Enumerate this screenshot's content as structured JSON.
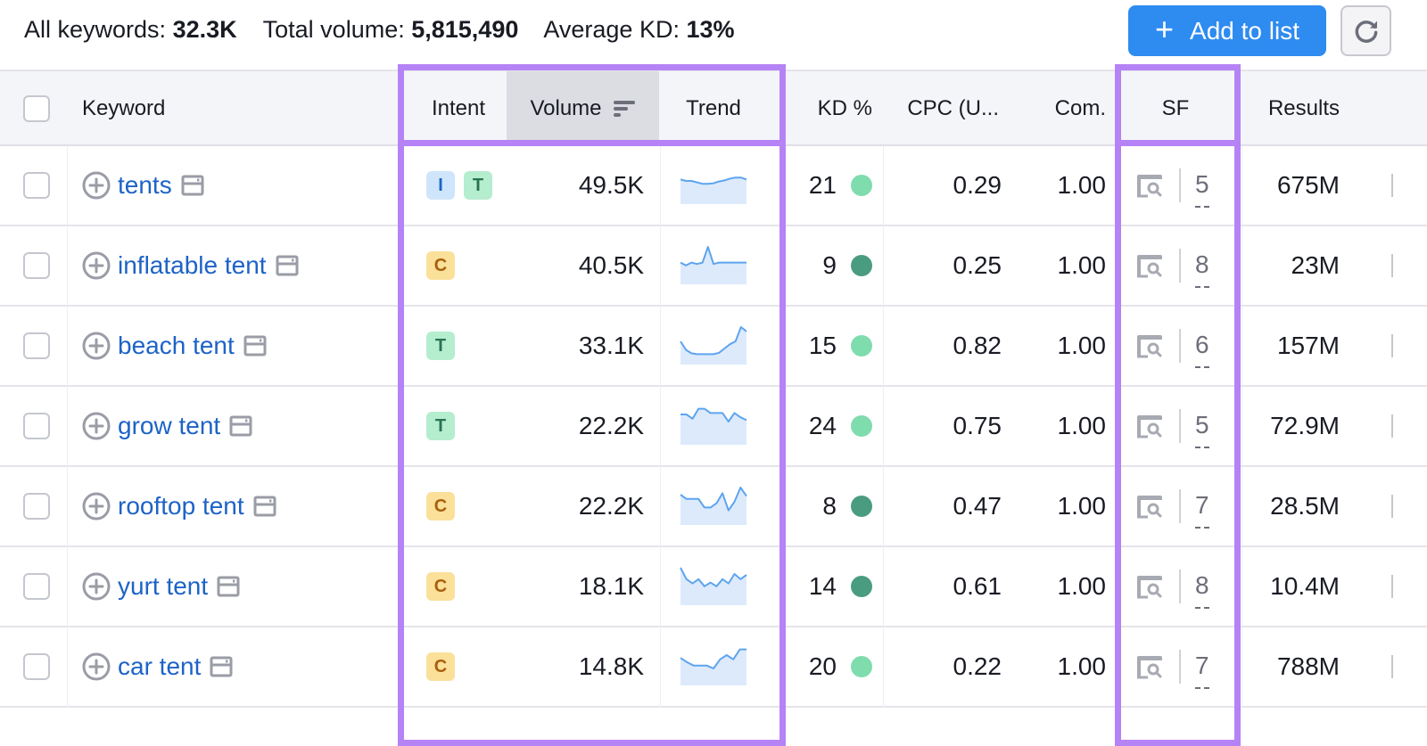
{
  "summary": {
    "all_keywords_label": "All keywords:",
    "all_keywords_value": "32.3K",
    "total_volume_label": "Total volume:",
    "total_volume_value": "5,815,490",
    "avg_kd_label": "Average KD:",
    "avg_kd_value": "13%"
  },
  "toolbar": {
    "add_to_list_label": "Add to list",
    "add_icon": "plus-icon",
    "refresh_icon": "refresh-icon"
  },
  "colors": {
    "accent": "#2e8bf0",
    "highlight": "#b583f5",
    "link": "#1d63c7",
    "kd_easy": "#7fdcad",
    "kd_very_easy": "#4a9c80",
    "trend_line": "#5ea4ee",
    "trend_fill": "#dceafc"
  },
  "columns": {
    "keyword": "Keyword",
    "intent": "Intent",
    "volume": "Volume",
    "trend": "Trend",
    "kd": "KD %",
    "cpc": "CPC (U...",
    "com": "Com.",
    "sf": "SF",
    "results": "Results"
  },
  "intent_styles": {
    "I": {
      "bg": "#cfe5fb",
      "fg": "#1d63c7"
    },
    "T": {
      "bg": "#b5edcf",
      "fg": "#287352"
    },
    "C": {
      "bg": "#fbe09a",
      "fg": "#a8600b"
    }
  },
  "rows": [
    {
      "keyword": "tents",
      "intents": [
        "I",
        "T"
      ],
      "volume": "49.5K",
      "trend": [
        0.55,
        0.5,
        0.5,
        0.45,
        0.4,
        0.4,
        0.42,
        0.48,
        0.52,
        0.58,
        0.62,
        0.62,
        0.55
      ],
      "kd": "21",
      "kd_level": "easy",
      "cpc": "0.29",
      "com": "1.00",
      "sf": "5",
      "results": "675M"
    },
    {
      "keyword": "inflatable tent",
      "intents": [
        "C"
      ],
      "volume": "40.5K",
      "trend": [
        0.45,
        0.35,
        0.45,
        0.4,
        0.45,
        1.0,
        0.4,
        0.45,
        0.45,
        0.45,
        0.45,
        0.45,
        0.45
      ],
      "kd": "9",
      "kd_level": "very_easy",
      "cpc": "0.25",
      "com": "1.00",
      "sf": "8",
      "results": "23M"
    },
    {
      "keyword": "beach tent",
      "intents": [
        "T"
      ],
      "volume": "33.1K",
      "trend": [
        0.5,
        0.2,
        0.08,
        0.05,
        0.05,
        0.05,
        0.05,
        0.1,
        0.25,
        0.4,
        0.5,
        1.0,
        0.85
      ],
      "kd": "15",
      "kd_level": "easy",
      "cpc": "0.82",
      "com": "1.00",
      "sf": "6",
      "results": "157M"
    },
    {
      "keyword": "grow tent",
      "intents": [
        "T"
      ],
      "volume": "22.2K",
      "trend": [
        0.75,
        0.75,
        0.6,
        0.95,
        0.95,
        0.8,
        0.8,
        0.8,
        0.5,
        0.8,
        0.65,
        0.55
      ],
      "kd": "24",
      "kd_level": "easy",
      "cpc": "0.75",
      "com": "1.00",
      "sf": "5",
      "results": "72.9M"
    },
    {
      "keyword": "rooftop tent",
      "intents": [
        "C"
      ],
      "volume": "22.2K",
      "trend": [
        0.75,
        0.6,
        0.6,
        0.6,
        0.3,
        0.3,
        0.45,
        0.8,
        0.2,
        0.5,
        1.0,
        0.7
      ],
      "kd": "8",
      "kd_level": "very_easy",
      "cpc": "0.47",
      "com": "1.00",
      "sf": "7",
      "results": "28.5M"
    },
    {
      "keyword": "yurt tent",
      "intents": [
        "C"
      ],
      "volume": "18.1K",
      "trend": [
        1.0,
        0.6,
        0.45,
        0.6,
        0.35,
        0.48,
        0.35,
        0.6,
        0.45,
        0.78,
        0.6,
        0.75
      ],
      "kd": "14",
      "kd_level": "very_easy",
      "cpc": "0.61",
      "com": "1.00",
      "sf": "8",
      "results": "10.4M"
    },
    {
      "keyword": "car tent",
      "intents": [
        "C"
      ],
      "volume": "14.8K",
      "trend": [
        0.65,
        0.5,
        0.38,
        0.38,
        0.38,
        0.28,
        0.6,
        0.75,
        0.6,
        0.95,
        0.95
      ],
      "kd": "20",
      "kd_level": "easy",
      "cpc": "0.22",
      "com": "1.00",
      "sf": "7",
      "results": "788M"
    }
  ]
}
